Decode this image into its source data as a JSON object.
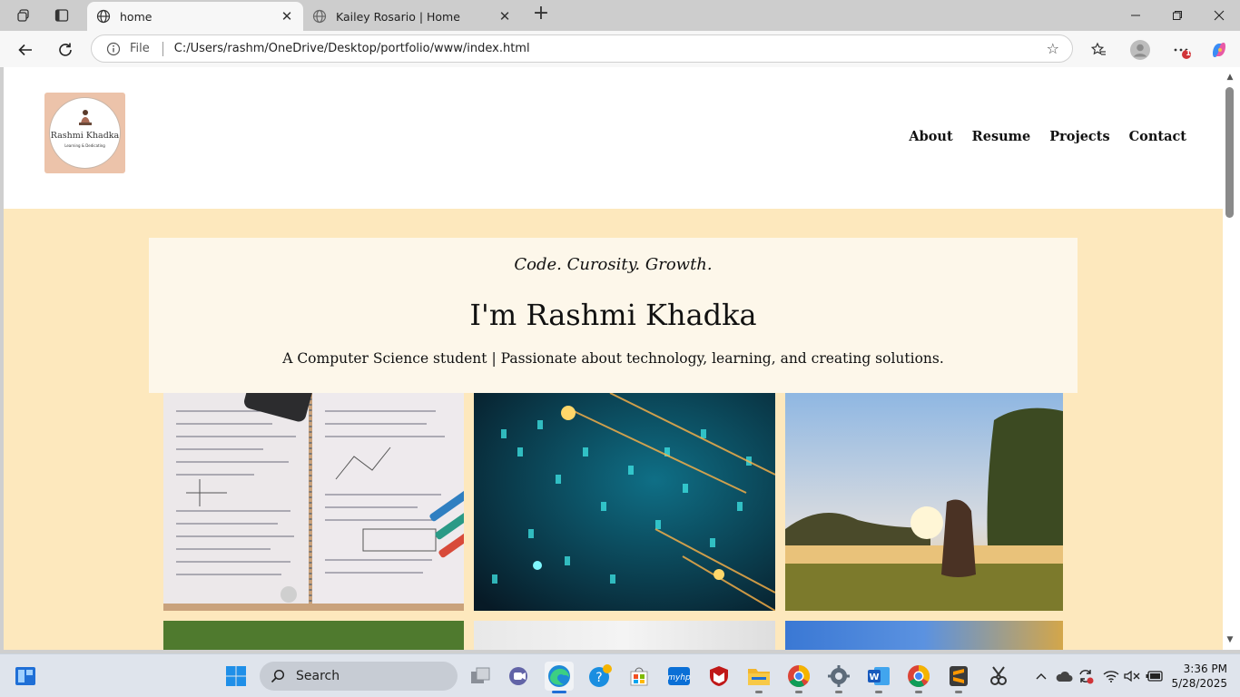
{
  "browser": {
    "tabs": [
      {
        "title": "home",
        "active": true
      },
      {
        "title": "Kailey Rosario | Home",
        "active": false
      }
    ],
    "address": {
      "scheme_label": "File",
      "url": "C:/Users/rashm/OneDrive/Desktop/portfolio/www/index.html"
    },
    "notification_count": "1"
  },
  "site": {
    "logo": {
      "name": "Rashmi Khadka",
      "tagline": "Learning & Dedicating"
    },
    "nav": [
      "About",
      "Resume",
      "Projects",
      "Contact"
    ],
    "hero": {
      "tagline": "Code. Curosity. Growth.",
      "headline": "I'm Rashmi Khadka",
      "subtitle": "A Computer Science student | Passionate about technology, learning, and creating solutions."
    },
    "colors": {
      "hero_bg": "#fde8bd",
      "hero_card": "#fdf7ea",
      "logo_bg": "#ecc3aa"
    }
  },
  "taskbar": {
    "search_placeholder": "Search",
    "time": "3:36 PM",
    "date": "5/28/2025"
  }
}
